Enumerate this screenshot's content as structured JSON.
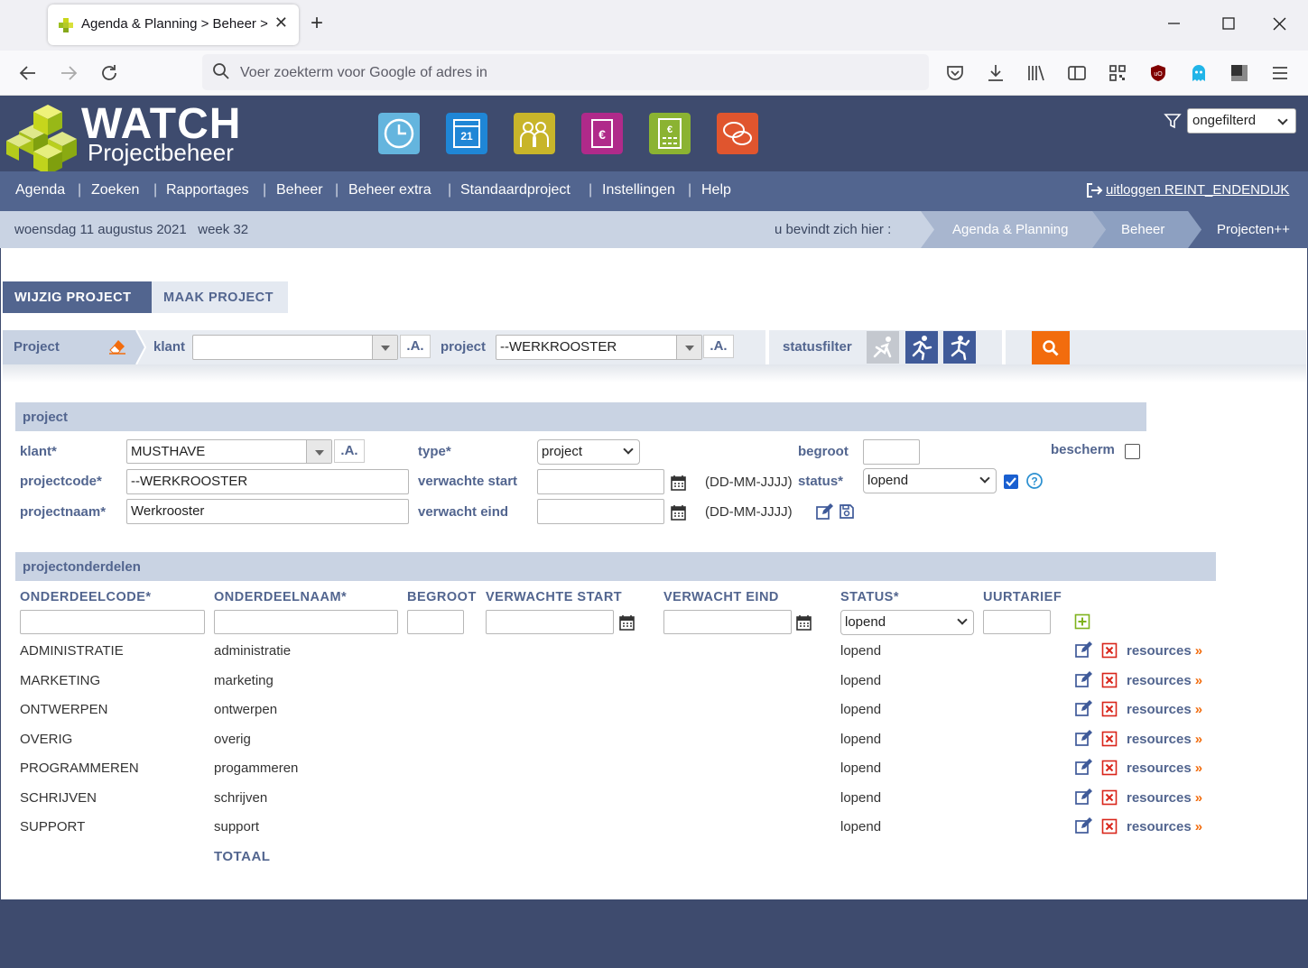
{
  "browser": {
    "tab_title": "Agenda & Planning > Beheer > Proj",
    "url_placeholder": "Voer zoekterm voor Google of adres in",
    "new_tab": "+",
    "close_tab": "✕"
  },
  "header": {
    "logo_title": "WATCH",
    "logo_subtitle": "Projectbeheer",
    "app_icons": [
      "clock-app-icon",
      "calendar-app-icon",
      "people-app-icon",
      "invoice-app-icon",
      "calculator-app-icon",
      "chat-app-icon"
    ],
    "filter_value": "ongefilterd"
  },
  "menu": {
    "items": [
      "Agenda",
      "Zoeken",
      "Rapportages",
      "Beheer",
      "Beheer extra",
      "Standaardproject",
      "Instellingen",
      "Help"
    ],
    "separator": "|",
    "logout": "uitloggen REINT_ENDENDIJK"
  },
  "crumbbar": {
    "date": "woensdag 11 augustus 2021",
    "week": "week 32",
    "here": "u bevindt zich hier :",
    "crumbs": [
      "Agenda & Planning",
      "Beheer",
      "Projecten++"
    ]
  },
  "tabs": {
    "wijzig": "WIJZIG PROJECT",
    "maak": "MAAK PROJECT"
  },
  "filterbar": {
    "project_label": "Project",
    "klant_label": "klant",
    "klant_value": "",
    "a_button": ".A.",
    "project_field_label": "project",
    "project_value": "--WERKROOSTER",
    "statusfilter_label": "statusfilter"
  },
  "project_form": {
    "section_title": "project",
    "klant_label": "klant*",
    "klant_value": "MUSTHAVE",
    "projectcode_label": "projectcode*",
    "projectcode_value": "--WERKROOSTER",
    "projectnaam_label": "projectnaam*",
    "projectnaam_value": "Werkrooster",
    "type_label": "type*",
    "type_value": "project",
    "verwachte_start_label": "verwachte start",
    "verwacht_eind_label": "verwacht eind",
    "date_hint": "(DD-MM-JJJJ)",
    "begroot_label": "begroot",
    "status_label": "status*",
    "status_value": "lopend",
    "bescherm_label": "bescherm",
    "status_checked": true
  },
  "onderdelen": {
    "section_title": "projectonderdelen",
    "columns": [
      "ONDERDEELCODE*",
      "ONDERDEELNAAM*",
      "BEGROOT",
      "VERWACHTE START",
      "VERWACHT EIND",
      "STATUS*",
      "UURTARIEF"
    ],
    "new_status_value": "lopend",
    "rows": [
      {
        "code": "ADMINISTRATIE",
        "naam": "administratie",
        "status": "lopend",
        "link": "resources"
      },
      {
        "code": "MARKETING",
        "naam": "marketing",
        "status": "lopend",
        "link": "resources"
      },
      {
        "code": "ONTWERPEN",
        "naam": "ontwerpen",
        "status": "lopend",
        "link": "resources"
      },
      {
        "code": "OVERIG",
        "naam": "overig",
        "status": "lopend",
        "link": "resources"
      },
      {
        "code": "PROGRAMMEREN",
        "naam": "progammeren",
        "status": "lopend",
        "link": "resources"
      },
      {
        "code": "SCHRIJVEN",
        "naam": "schrijven",
        "status": "lopend",
        "link": "resources"
      },
      {
        "code": "SUPPORT",
        "naam": "support",
        "status": "lopend",
        "link": "resources"
      }
    ],
    "arrow": "»",
    "totaal": "TOTAAL"
  },
  "colors": {
    "dark_navy": "#3e4b6e",
    "menu_blue": "#52658f",
    "light_blue": "#c9d3e3",
    "accent_orange": "#f26c0d",
    "delete_red": "#d9261c"
  }
}
